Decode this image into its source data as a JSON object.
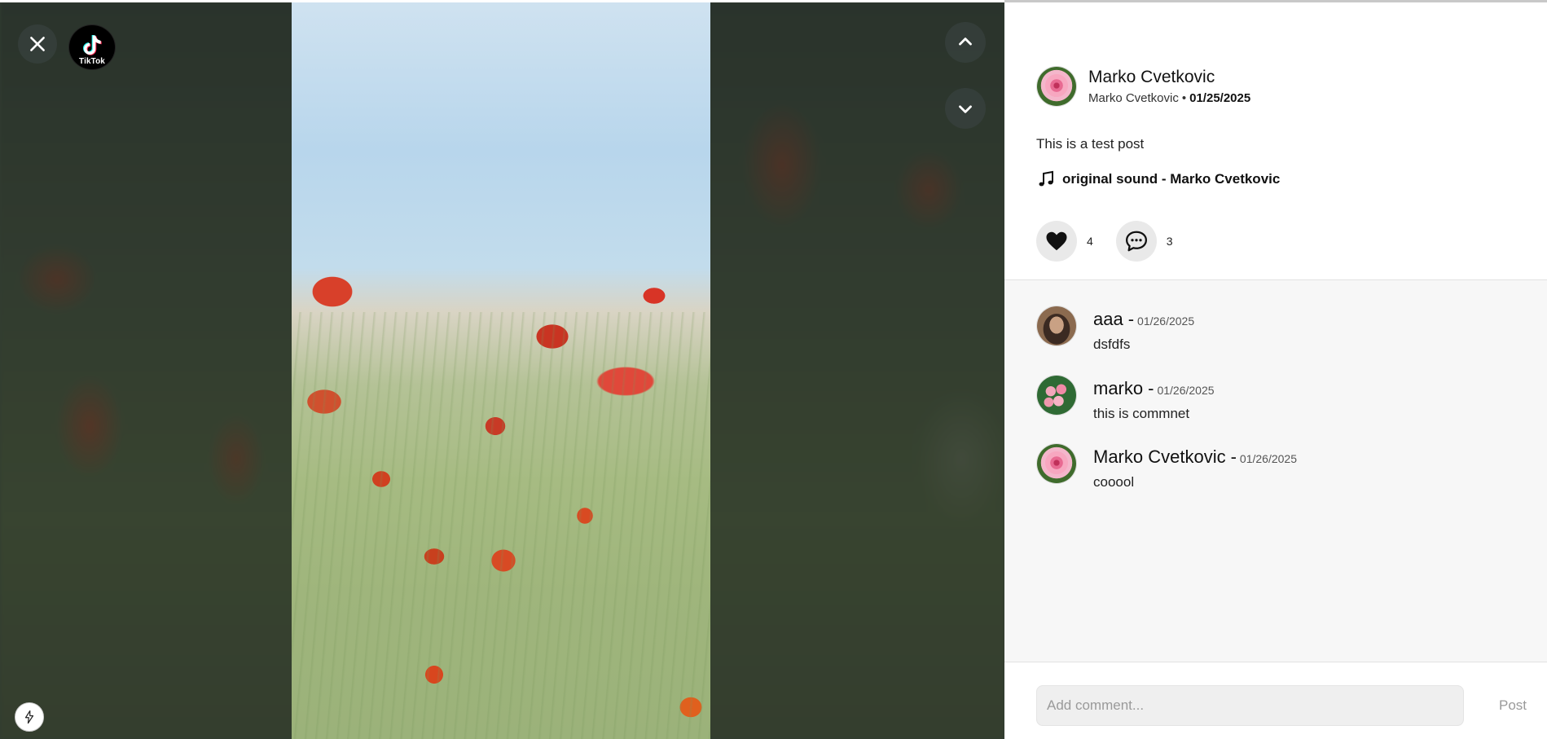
{
  "logo": {
    "text": "TikTok"
  },
  "post": {
    "author_name": "Marko Cvetkovic",
    "author_handle": "Marko Cvetkovic",
    "separator": "•",
    "date": "01/25/2025",
    "caption": "This is a test post",
    "sound": "original sound - Marko Cvetkovic",
    "likes": "4",
    "comments_count": "3"
  },
  "comments": [
    {
      "name": "aaa",
      "sep": "-",
      "date": "01/26/2025",
      "text": "dsfdfs",
      "avatar": "girl-avatar"
    },
    {
      "name": "marko",
      "sep": "-",
      "date": "01/26/2025",
      "text": "this is commnet",
      "avatar": "flower-avatar"
    },
    {
      "name": "Marko Cvetkovic",
      "sep": "-",
      "date": "01/26/2025",
      "text": "cooool",
      "avatar": "rose-avatar"
    }
  ],
  "comment_box": {
    "placeholder": "Add comment...",
    "post_label": "Post"
  },
  "icons": {
    "close": "close-icon",
    "up": "chevron-up-icon",
    "down": "chevron-down-icon",
    "like": "heart-icon",
    "comment": "comment-bubble-icon",
    "music": "music-note-icon",
    "bolt": "lightning-icon"
  },
  "colors": {
    "panel_bg": "#ffffff",
    "comments_bg": "#f7f7f7",
    "action_btn_bg": "#e9e9e9"
  }
}
